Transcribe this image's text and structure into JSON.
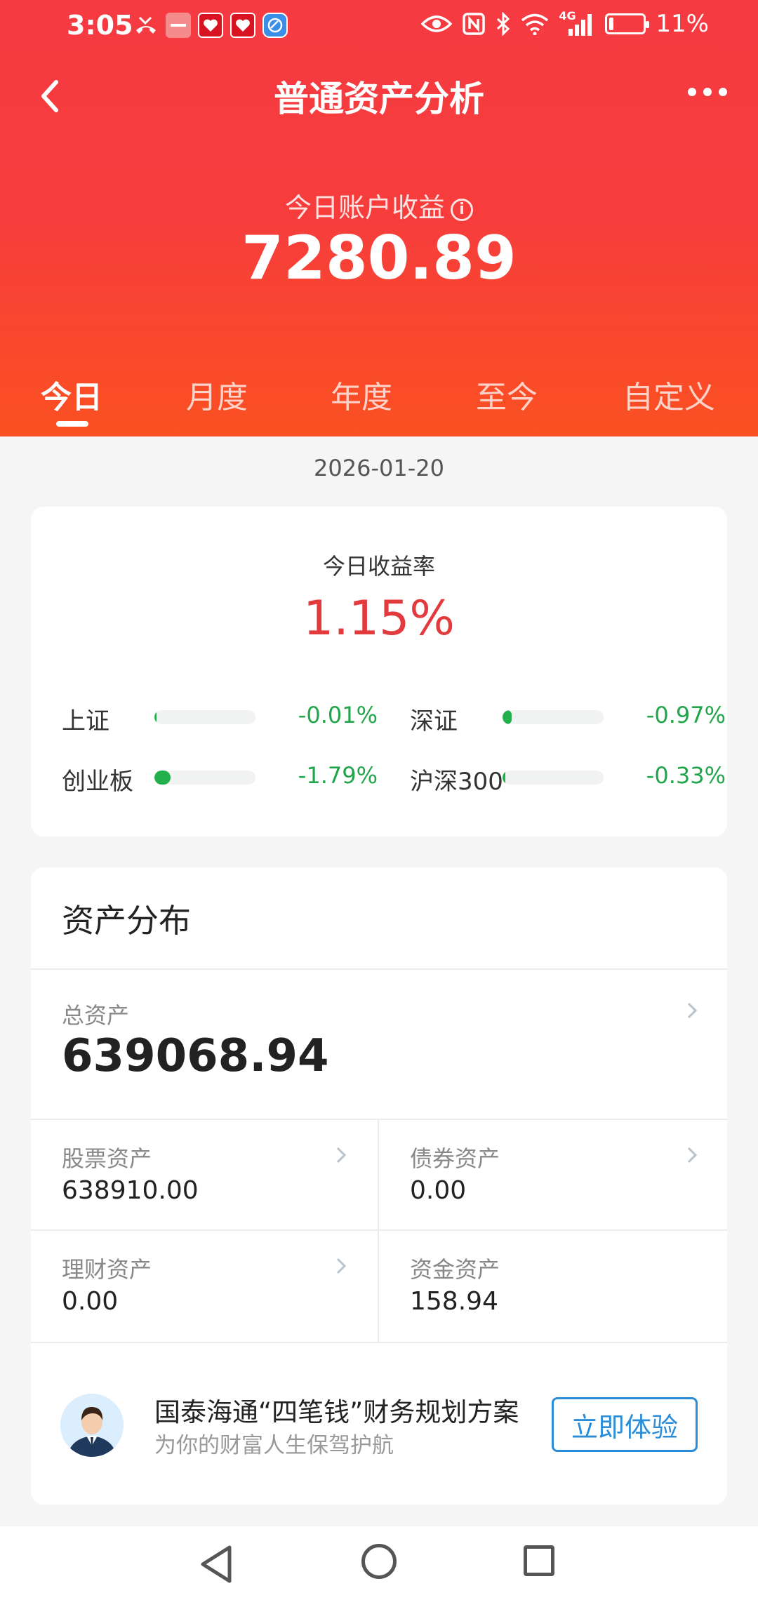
{
  "status_bar": {
    "time": "3:05",
    "battery": "11%",
    "battery_level": 0.11,
    "left_icons": [
      "missed-call-icon",
      "huawei-icon",
      "app-red-icon-1",
      "app-red-icon-2",
      "browser-icon"
    ],
    "right_icons": [
      "eye-icon",
      "nfc-icon",
      "bluetooth-icon",
      "wifi-icon",
      "signal-4g-icon",
      "battery-icon"
    ],
    "network_label": "4G"
  },
  "nav": {
    "title": "普通资产分析"
  },
  "earnings": {
    "label": "今日账户收益",
    "value": "7280.89"
  },
  "tabs": [
    {
      "label": "今日",
      "active": true
    },
    {
      "label": "月度",
      "active": false
    },
    {
      "label": "年度",
      "active": false
    },
    {
      "label": "至今",
      "active": false
    },
    {
      "label": "自定义",
      "active": false
    }
  ],
  "date": "2026-01-20",
  "rate_card": {
    "label": "今日收益率",
    "value": "1.15%",
    "indices": [
      {
        "name": "上证",
        "value": "-0.01%",
        "bar_fraction": 0.01
      },
      {
        "name": "深证",
        "value": "-0.97%",
        "bar_fraction": 0.09
      },
      {
        "name": "创业板",
        "value": "-1.79%",
        "bar_fraction": 0.16
      },
      {
        "name": "沪深300",
        "value": "-0.33%",
        "bar_fraction": 0.03
      }
    ]
  },
  "distribution": {
    "title": "资产分布",
    "total_label": "总资产",
    "total_value": "639068.94",
    "cells": [
      {
        "label": "股票资产",
        "value": "638910.00",
        "has_arrow": true
      },
      {
        "label": "债券资产",
        "value": "0.00",
        "has_arrow": true
      },
      {
        "label": "理财资产",
        "value": "0.00",
        "has_arrow": true
      },
      {
        "label": "资金资产",
        "value": "158.94",
        "has_arrow": false
      }
    ],
    "promo": {
      "title": "国泰海通“四笔钱”财务规划方案",
      "subtitle": "为你的财富人生保驾护航",
      "button": "立即体验"
    }
  },
  "colors": {
    "header_top": "#f63a42",
    "header_bottom": "#fb5021",
    "positive": "#e23a3d",
    "negative": "#21a54a",
    "link": "#2b8cd8"
  }
}
